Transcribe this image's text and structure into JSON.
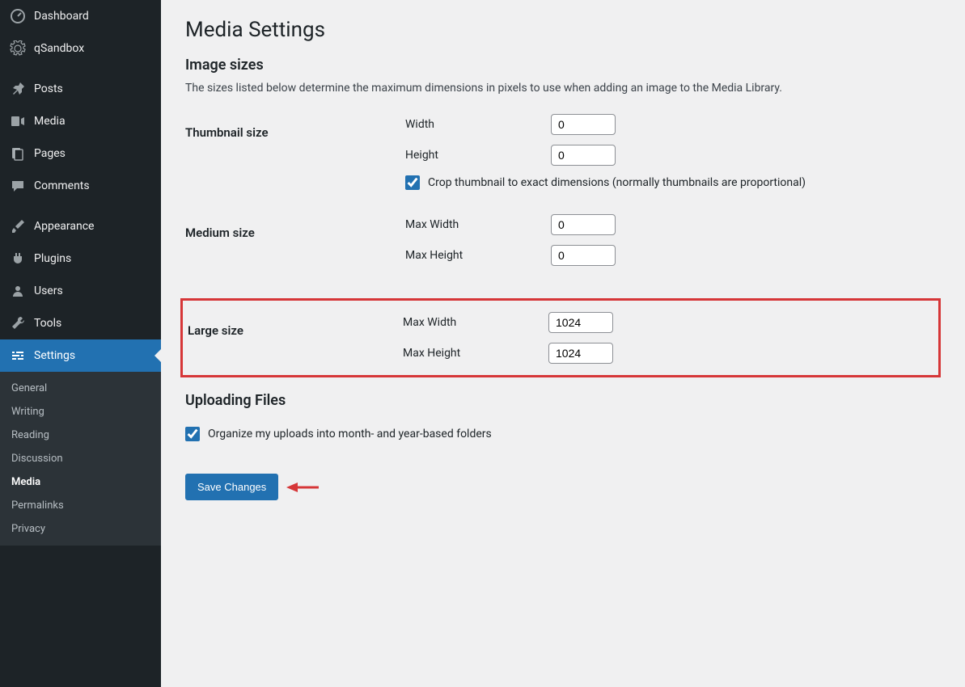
{
  "sidebar": {
    "items": [
      {
        "label": "Dashboard",
        "icon": "dashboard"
      },
      {
        "label": "qSandbox",
        "icon": "gear"
      },
      {
        "label": "Posts",
        "icon": "pin"
      },
      {
        "label": "Media",
        "icon": "media"
      },
      {
        "label": "Pages",
        "icon": "pages"
      },
      {
        "label": "Comments",
        "icon": "comment"
      },
      {
        "label": "Appearance",
        "icon": "brush"
      },
      {
        "label": "Plugins",
        "icon": "plug"
      },
      {
        "label": "Users",
        "icon": "user"
      },
      {
        "label": "Tools",
        "icon": "wrench"
      },
      {
        "label": "Settings",
        "icon": "sliders"
      }
    ],
    "submenu": [
      "General",
      "Writing",
      "Reading",
      "Discussion",
      "Media",
      "Permalinks",
      "Privacy"
    ]
  },
  "page": {
    "title": "Media Settings",
    "section_image_sizes": "Image sizes",
    "image_sizes_desc": "The sizes listed below determine the maximum dimensions in pixels to use when adding an image to the Media Library.",
    "thumbnail": {
      "label": "Thumbnail size",
      "width_label": "Width",
      "width_value": "0",
      "height_label": "Height",
      "height_value": "0",
      "crop_checked": true,
      "crop_label": "Crop thumbnail to exact dimensions (normally thumbnails are proportional)"
    },
    "medium": {
      "label": "Medium size",
      "max_width_label": "Max Width",
      "max_width_value": "0",
      "max_height_label": "Max Height",
      "max_height_value": "0"
    },
    "large": {
      "label": "Large size",
      "max_width_label": "Max Width",
      "max_width_value": "1024",
      "max_height_label": "Max Height",
      "max_height_value": "1024"
    },
    "uploading_title": "Uploading Files",
    "organize": {
      "checked": true,
      "label": "Organize my uploads into month- and year-based folders"
    },
    "save_label": "Save Changes"
  }
}
